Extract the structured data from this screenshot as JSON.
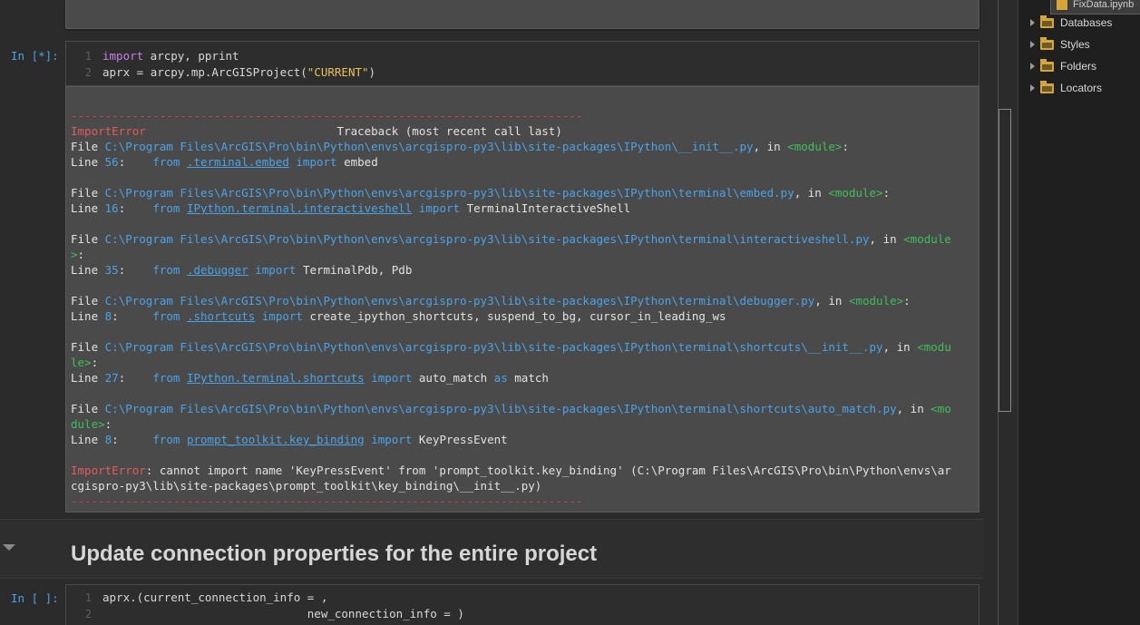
{
  "cells": {
    "cell1": {
      "prompt": "In [*]:",
      "lines": [
        {
          "num": "1"
        },
        {
          "num": "2"
        }
      ],
      "code": {
        "l1_kw": "import",
        "l1_rest": " arcpy, pprint",
        "l2_a": "aprx ",
        "l2_eq": "=",
        "l2_b": " arcpy.mp.ArcGISProject(",
        "l2_str": "\"CURRENT\"",
        "l2_c": ")"
      }
    },
    "cell2": {
      "prompt": "In [ ]:",
      "lines": [
        {
          "num": "1"
        },
        {
          "num": "2"
        }
      ],
      "code": {
        "l1_a": "aprx.(current_connection_info ",
        "l1_eq": "=",
        "l1_b": " ,",
        "l2_a": "                              new_connection_info ",
        "l2_eq": "=",
        "l2_b": " )"
      }
    }
  },
  "traceback": {
    "dashes": "---------------------------------------------------------------------------",
    "error_name": "ImportError",
    "header_gap": "                            ",
    "header_right": "Traceback (most recent call last)",
    "file_label": "File ",
    "in_label": ", in ",
    "line_label": "Line ",
    "frames": [
      {
        "path": "C:\\Program Files\\ArcGIS\\Pro\\bin\\Python\\envs\\arcgispro-py3\\lib\\site-packages\\IPython\\__init__.py",
        "module": "<module>",
        "module_tail": "",
        "line_no": "56",
        "pad": "    ",
        "from": "from",
        "target": ".terminal.embed",
        "import": "import",
        "names": "embed"
      },
      {
        "path": "C:\\Program Files\\ArcGIS\\Pro\\bin\\Python\\envs\\arcgispro-py3\\lib\\site-packages\\IPython\\terminal\\embed.py",
        "module": "<module>",
        "module_tail": "",
        "line_no": "16",
        "pad": "    ",
        "from": "from",
        "target": "IPython.terminal.interactiveshell",
        "import": "import",
        "names": "TerminalInteractiveShell"
      },
      {
        "path": "C:\\Program Files\\ArcGIS\\Pro\\bin\\Python\\envs\\arcgispro-py3\\lib\\site-packages\\IPython\\terminal\\interactiveshell.py",
        "module": "<module",
        "module_tail": ">",
        "line_no": "35",
        "pad": "    ",
        "from": "from",
        "target": ".debugger",
        "import": "import",
        "names": "TerminalPdb, Pdb"
      },
      {
        "path": "C:\\Program Files\\ArcGIS\\Pro\\bin\\Python\\envs\\arcgispro-py3\\lib\\site-packages\\IPython\\terminal\\debugger.py",
        "module": "<module>",
        "module_tail": "",
        "line_no": "8",
        "pad": "     ",
        "from": "from",
        "target": ".shortcuts",
        "import": "import",
        "names": "create_ipython_shortcuts, suspend_to_bg, cursor_in_leading_ws"
      },
      {
        "path": "C:\\Program Files\\ArcGIS\\Pro\\bin\\Python\\envs\\arcgispro-py3\\lib\\site-packages\\IPython\\terminal\\shortcuts\\__init__.py",
        "module": "<modu",
        "module_tail": "le>",
        "line_no": "27",
        "pad": "    ",
        "from": "from",
        "target": "IPython.terminal.shortcuts",
        "import": "import",
        "names": "auto_match",
        "as": "as",
        "alias": "match"
      },
      {
        "path": "C:\\Program Files\\ArcGIS\\Pro\\bin\\Python\\envs\\arcgispro-py3\\lib\\site-packages\\IPython\\terminal\\shortcuts\\auto_match.py",
        "module": "<mo",
        "module_tail": "dule>",
        "line_no": "8",
        "pad": "     ",
        "from": "from",
        "target": "prompt_toolkit.key_binding",
        "import": "import",
        "names": "KeyPressEvent"
      }
    ],
    "final_name": "ImportError",
    "final_msg_1": ": cannot import name 'KeyPressEvent' from 'prompt_toolkit.key_binding' (C:\\Program Files\\ArcGIS\\Pro\\bin\\Python\\envs\\ar",
    "final_msg_2": "cgispro-py3\\lib\\site-packages\\prompt_toolkit\\key_binding\\__init__.py)"
  },
  "markdown": {
    "heading": "Update connection properties for the entire project"
  },
  "catalog": {
    "open_file": "FixData.ipynb",
    "items": [
      {
        "label": "Databases"
      },
      {
        "label": "Styles"
      },
      {
        "label": "Folders"
      },
      {
        "label": "Locators"
      }
    ]
  },
  "colors": {
    "error": "#e45a5a",
    "path": "#4aa3e8",
    "module": "#3fbf5a",
    "keyword": "#c97ee8",
    "string": "#e8c35a",
    "folder": "#d7a436"
  }
}
